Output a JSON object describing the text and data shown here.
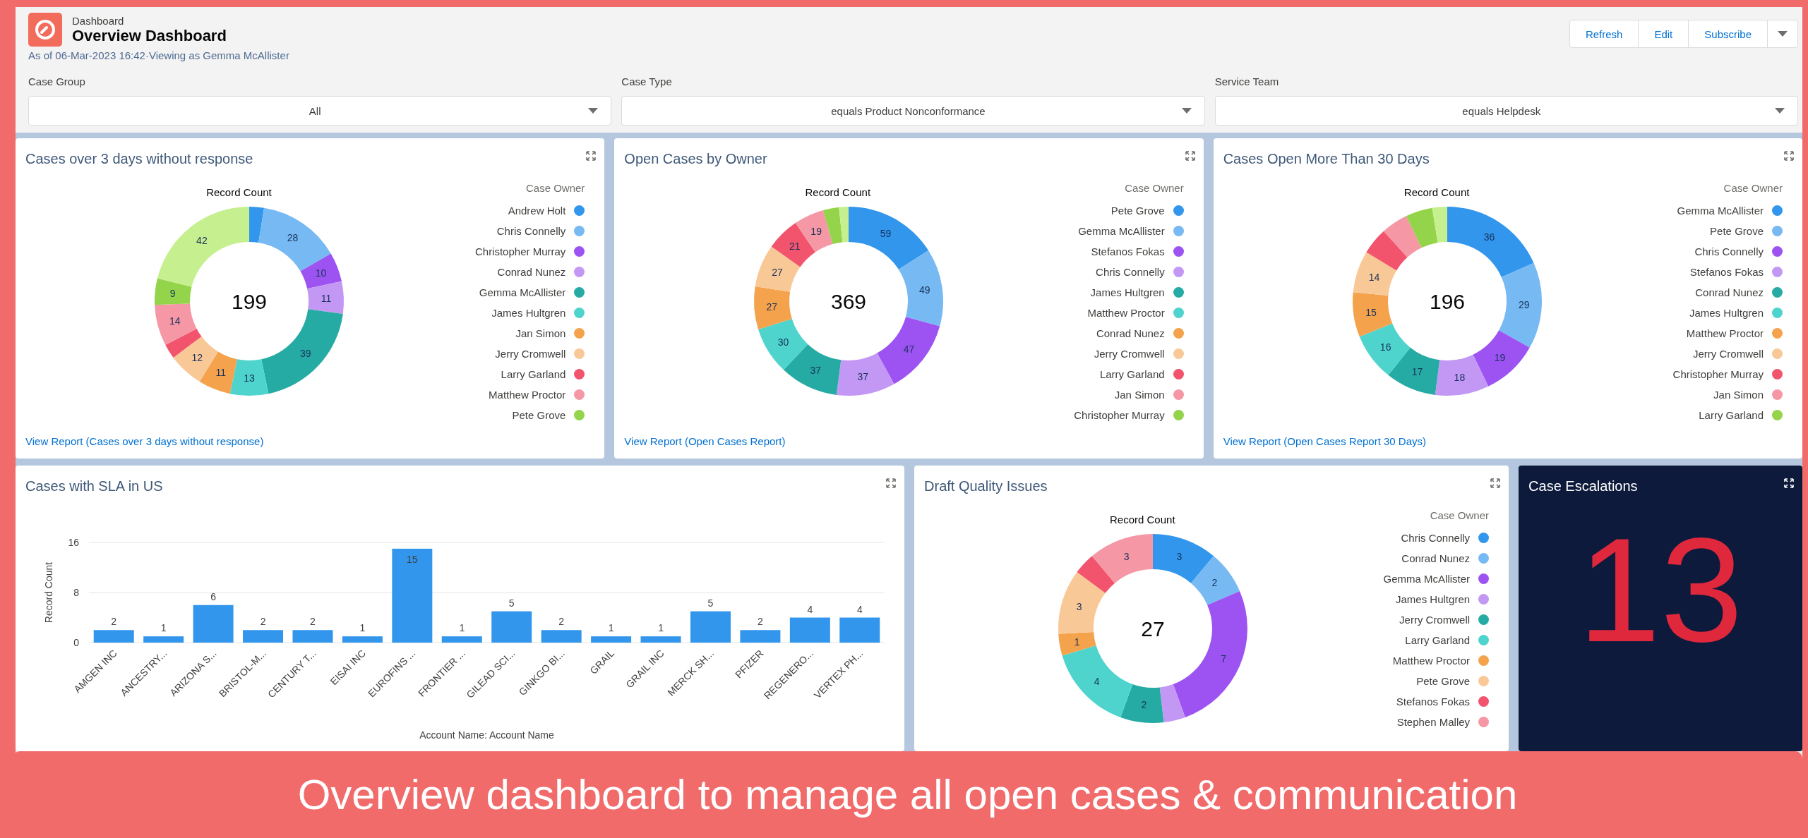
{
  "header": {
    "breadcrumb": "Dashboard",
    "title": "Overview Dashboard",
    "subtitle": "As of 06-Mar-2023 16:42·Viewing as Gemma McAllister",
    "buttons": [
      "Refresh",
      "Edit",
      "Subscribe"
    ]
  },
  "filters": [
    {
      "label": "Case Group",
      "value": "All"
    },
    {
      "label": "Case Type",
      "value": "equals Product Nonconformance"
    },
    {
      "label": "Service Team",
      "value": "equals Helpdesk"
    }
  ],
  "rows": [
    [
      {
        "kind": "donut",
        "title": "Cases over 3 days without response",
        "total": "199",
        "link": "View Report (Cases over 3 days without response)",
        "legend": {
          "title": "Case Owner",
          "items": [
            {
              "name": "Andrew Holt",
              "color": "#3296ed"
            },
            {
              "name": "Chris Connelly",
              "color": "#77b9f2"
            },
            {
              "name": "Christopher Murray",
              "color": "#9d53f2"
            },
            {
              "name": "Conrad Nunez",
              "color": "#c398f5"
            },
            {
              "name": "Gemma McAllister",
              "color": "#26aba4"
            },
            {
              "name": "James Hultgren",
              "color": "#4ed4cd"
            },
            {
              "name": "Jan Simon",
              "color": "#f4a24b"
            },
            {
              "name": "Jerry Cromwell",
              "color": "#f9c897"
            },
            {
              "name": "Larry Garland",
              "color": "#f2536d"
            },
            {
              "name": "Matthew Proctor",
              "color": "#f597a4"
            },
            {
              "name": "Pete Grove",
              "color": "#93d44b"
            }
          ]
        },
        "chart_data": {
          "type": "donut",
          "title": "Record Count",
          "values": [
            5,
            28,
            10,
            11,
            39,
            13,
            11,
            12,
            5,
            14,
            9,
            42
          ],
          "colors": [
            "#3296ed",
            "#77b9f2",
            "#9d53f2",
            "#c398f5",
            "#26aba4",
            "#4ed4cd",
            "#f4a24b",
            "#f9c897",
            "#f2536d",
            "#f597a4",
            "#93d44b",
            "#c6f08f"
          ],
          "value_labels": [
            null,
            "28",
            "10",
            "11",
            "39",
            "13",
            "11",
            "12",
            null,
            "14",
            "9",
            "42"
          ]
        }
      },
      {
        "kind": "donut",
        "title": "Open Cases by Owner",
        "total": "369",
        "link": "View Report (Open Cases Report)",
        "legend": {
          "title": "Case Owner",
          "items": [
            {
              "name": "Pete Grove",
              "color": "#3296ed"
            },
            {
              "name": "Gemma McAllister",
              "color": "#77b9f2"
            },
            {
              "name": "Stefanos Fokas",
              "color": "#9d53f2"
            },
            {
              "name": "Chris Connelly",
              "color": "#c398f5"
            },
            {
              "name": "James Hultgren",
              "color": "#26aba4"
            },
            {
              "name": "Matthew Proctor",
              "color": "#4ed4cd"
            },
            {
              "name": "Conrad Nunez",
              "color": "#f4a24b"
            },
            {
              "name": "Jerry Cromwell",
              "color": "#f9c897"
            },
            {
              "name": "Larry Garland",
              "color": "#f2536d"
            },
            {
              "name": "Jan Simon",
              "color": "#f597a4"
            },
            {
              "name": "Christopher Murray",
              "color": "#93d44b"
            }
          ]
        },
        "chart_data": {
          "type": "donut",
          "title": "Record Count",
          "values": [
            59,
            49,
            47,
            37,
            37,
            30,
            27,
            27,
            21,
            19,
            10,
            6
          ],
          "colors": [
            "#3296ed",
            "#77b9f2",
            "#9d53f2",
            "#c398f5",
            "#26aba4",
            "#4ed4cd",
            "#f4a24b",
            "#f9c897",
            "#f2536d",
            "#f597a4",
            "#93d44b",
            "#c6f08f"
          ],
          "value_labels": [
            "59",
            "49",
            "47",
            "37",
            "37",
            "30",
            "27",
            "27",
            "21",
            "19",
            null,
            null
          ]
        }
      },
      {
        "kind": "donut",
        "title": "Cases Open More Than 30 Days",
        "total": "196",
        "link": "View Report (Open Cases Report 30 Days)",
        "legend": {
          "title": "Case Owner",
          "items": [
            {
              "name": "Gemma McAllister",
              "color": "#3296ed"
            },
            {
              "name": "Pete Grove",
              "color": "#77b9f2"
            },
            {
              "name": "Chris Connelly",
              "color": "#9d53f2"
            },
            {
              "name": "Stefanos Fokas",
              "color": "#c398f5"
            },
            {
              "name": "Conrad Nunez",
              "color": "#26aba4"
            },
            {
              "name": "James Hultgren",
              "color": "#4ed4cd"
            },
            {
              "name": "Matthew Proctor",
              "color": "#f4a24b"
            },
            {
              "name": "Jerry Cromwell",
              "color": "#f9c897"
            },
            {
              "name": "Christopher Murray",
              "color": "#f2536d"
            },
            {
              "name": "Jan Simon",
              "color": "#f597a4"
            },
            {
              "name": "Larry Garland",
              "color": "#93d44b"
            }
          ]
        },
        "chart_data": {
          "type": "donut",
          "title": "Record Count",
          "values": [
            36,
            29,
            19,
            18,
            17,
            16,
            15,
            14,
            9,
            9,
            9,
            5
          ],
          "colors": [
            "#3296ed",
            "#77b9f2",
            "#9d53f2",
            "#c398f5",
            "#26aba4",
            "#4ed4cd",
            "#f4a24b",
            "#f9c897",
            "#f2536d",
            "#f597a4",
            "#93d44b",
            "#c6f08f"
          ],
          "value_labels": [
            "36",
            "29",
            "19",
            "18",
            "17",
            "16",
            "15",
            "14",
            null,
            null,
            null,
            null
          ]
        }
      }
    ],
    [
      {
        "kind": "bar",
        "title": "Cases with SLA in US",
        "chart_data": {
          "type": "bar",
          "categories": [
            "AMGEN INC",
            "ANCESTRY...",
            "ARIZONA S...",
            "BRISTOL-M...",
            "CENTURY T...",
            "EISAI INC",
            "EUROFINS ...",
            "FRONTIER ...",
            "GILEAD SCI...",
            "GINKGO BI...",
            "GRAIL",
            "GRAIL INC",
            "MERCK SH...",
            "PFIZER",
            "REGENERO...",
            "VERTEX PH..."
          ],
          "series": [
            {
              "color": "#3296ed",
              "values": [
                2,
                1,
                6,
                2,
                2,
                1,
                15,
                1,
                5,
                2,
                1,
                1,
                5,
                2,
                4,
                4
              ]
            }
          ],
          "ylim": [
            0,
            16
          ],
          "yticks": [
            0,
            8,
            16
          ],
          "ylabel": "Record Count",
          "xlabel": "Account Name: Account Name",
          "data_labels": true
        }
      },
      {
        "kind": "donut",
        "title": "Draft Quality Issues",
        "total": "27",
        "legend": {
          "title": "Case Owner",
          "items": [
            {
              "name": "Chris Connelly",
              "color": "#3296ed"
            },
            {
              "name": "Conrad Nunez",
              "color": "#77b9f2"
            },
            {
              "name": "Gemma McAllister",
              "color": "#9d53f2"
            },
            {
              "name": "James Hultgren",
              "color": "#c398f5"
            },
            {
              "name": "Jerry Cromwell",
              "color": "#26aba4"
            },
            {
              "name": "Larry Garland",
              "color": "#4ed4cd"
            },
            {
              "name": "Matthew Proctor",
              "color": "#f4a24b"
            },
            {
              "name": "Pete Grove",
              "color": "#f9c897"
            },
            {
              "name": "Stefanos Fokas",
              "color": "#f2536d"
            },
            {
              "name": "Stephen Malley",
              "color": "#f597a4"
            }
          ]
        },
        "chart_data": {
          "type": "donut",
          "title": "Record Count",
          "values": [
            3,
            2,
            7,
            1,
            2,
            4,
            1,
            3,
            1,
            3
          ],
          "colors": [
            "#3296ed",
            "#77b9f2",
            "#9d53f2",
            "#c398f5",
            "#26aba4",
            "#4ed4cd",
            "#f4a24b",
            "#f9c897",
            "#f2536d",
            "#f597a4"
          ],
          "value_labels": [
            "3",
            "2",
            "7",
            null,
            "2",
            "4",
            "1",
            "3",
            null,
            "3"
          ]
        }
      },
      {
        "kind": "metric",
        "title": "Case Escalations",
        "value": "13"
      }
    ]
  ],
  "banner": "Overview dashboard to manage all open cases & communication"
}
